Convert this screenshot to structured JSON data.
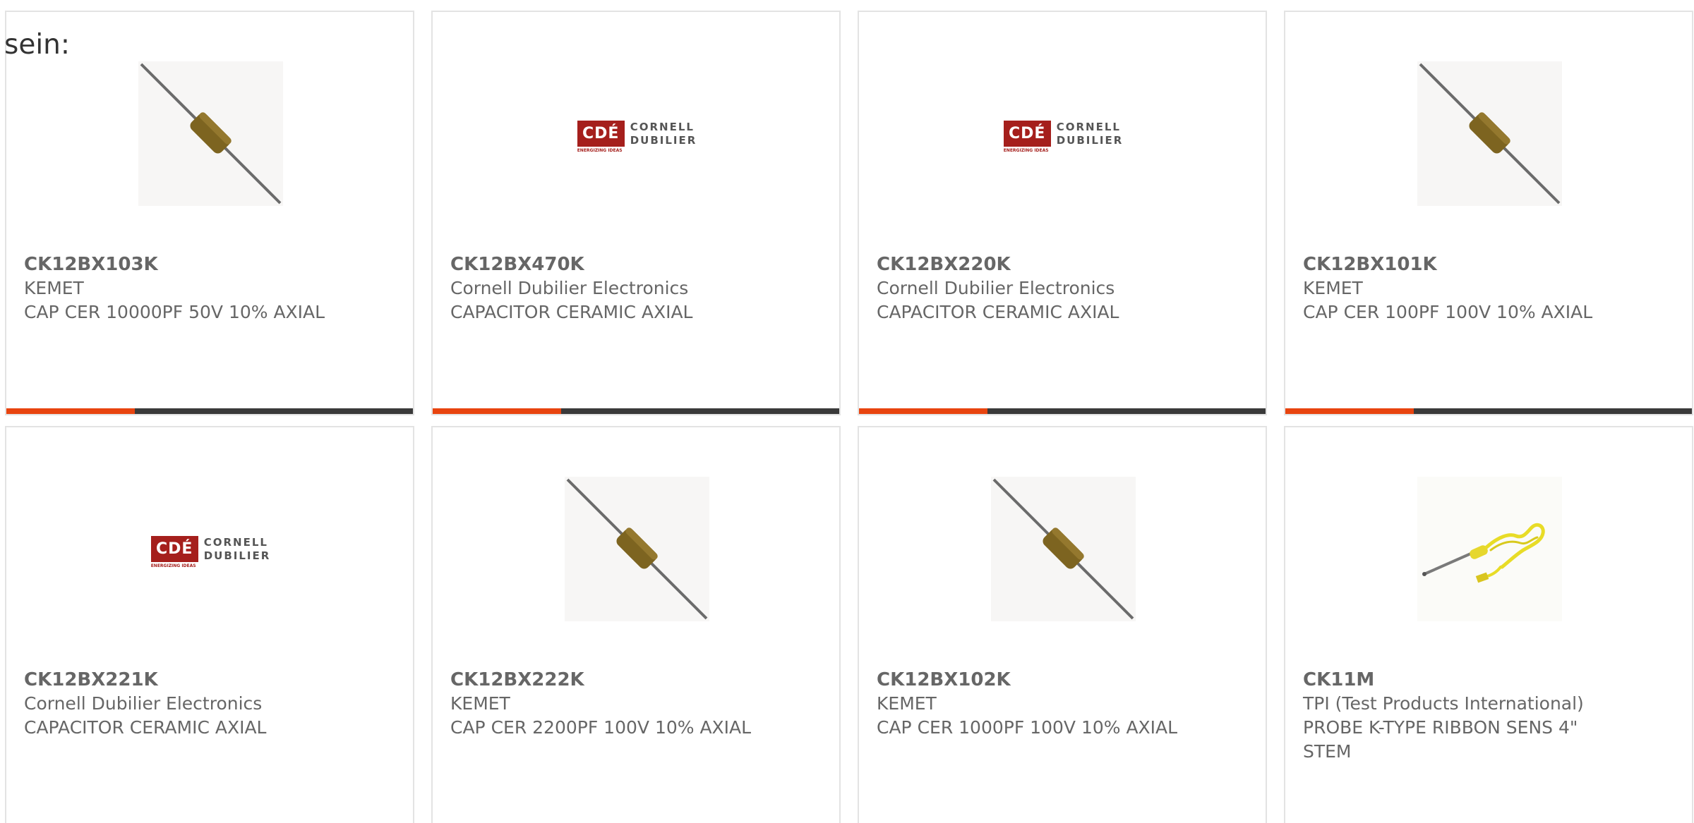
{
  "lead_text": "sein:",
  "colors": {
    "accent": "#e8440f",
    "bar": "#3a3a3a",
    "border": "#e3e3e3",
    "text": "#666666",
    "cde_red": "#a51f1c"
  },
  "products": [
    {
      "part_number": "CK12BX103K",
      "manufacturer": "KEMET",
      "description": "CAP CER 10000PF 50V 10% AXIAL",
      "image": "axial-capacitor-icon"
    },
    {
      "part_number": "CK12BX470K",
      "manufacturer": "Cornell Dubilier Electronics",
      "description": "CAPACITOR CERAMIC AXIAL",
      "image": "cornell-dubilier-logo"
    },
    {
      "part_number": "CK12BX220K",
      "manufacturer": "Cornell Dubilier Electronics",
      "description": "CAPACITOR CERAMIC AXIAL",
      "image": "cornell-dubilier-logo"
    },
    {
      "part_number": "CK12BX101K",
      "manufacturer": "KEMET",
      "description": "CAP CER 100PF 100V 10% AXIAL",
      "image": "axial-capacitor-icon"
    },
    {
      "part_number": "CK12BX221K",
      "manufacturer": "Cornell Dubilier Electronics",
      "description": "CAPACITOR CERAMIC AXIAL",
      "image": "cornell-dubilier-logo"
    },
    {
      "part_number": "CK12BX222K",
      "manufacturer": "KEMET",
      "description": "CAP CER 2200PF 100V 10% AXIAL",
      "image": "axial-capacitor-icon"
    },
    {
      "part_number": "CK12BX102K",
      "manufacturer": "KEMET",
      "description": "CAP CER 1000PF 100V 10% AXIAL",
      "image": "axial-capacitor-icon"
    },
    {
      "part_number": "CK11M",
      "manufacturer": "TPI (Test Products International)",
      "description": "PROBE K-TYPE RIBBON SENS 4\" STEM",
      "image": "temperature-probe-icon"
    }
  ],
  "cde_logo": {
    "mark": "CDÉ",
    "line1": "CORNELL",
    "line2": "DUBILIER",
    "tagline": "ENERGIZING IDEAS"
  }
}
